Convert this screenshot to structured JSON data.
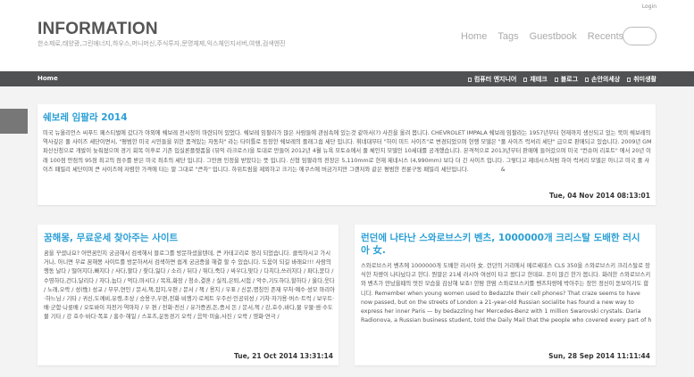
{
  "header": {
    "login": "Login",
    "site_title": "INFORMATION",
    "tagline": "한소제로,태양광,그린에너지,하우스,머니머신,주식투자,문명체제,익스체인지서버,여행,검색엔진",
    "nav": [
      "Home",
      "Tags",
      "Guestbook",
      "Recents"
    ]
  },
  "catbar": {
    "home": "Home",
    "items": [
      "컴퓨터 엔지니어",
      "재테크",
      "블로그",
      "손안의세상",
      "취미생활"
    ]
  },
  "posts": [
    {
      "title": "쉐보레 임팔라 2014",
      "body": "미국 뉴올리언스 씨푸드 페스티벌에 갔다가 야외에 쉐보레 전시장이 마련되어 있었다. 쉐보레 임팔라가 많은 사람들에 관심속에 있는것 같아서(?) 사진을 올려 봅니다. CHEVROLET IMPALA 쉐보레 임팔라는 1957년부터 현재까지 생산되고 있는 북미 쉐보레의 역사깊은 풀 사이즈 세단이면서, \"평범한 미국 시민들을 위한 품격있는 자동차\" 라는 타이틀로 등장한 쉐보레의 플래그쉽 세단 입니다. 휘네대부터 \"하이 미드 사이즈\"로 변경되었으며 현행 모델은 \"풀 사이즈 럭셔리 세단\" 급으로 판매되고 있습니다. 2009년 GM 파산신청으로 개발이 늦춰졌으며 경기 회복 이후로 기존 입실론플랫폼을 (뷰익 라크로스)을 토대로 만들어 2012년 4월 뉴욕 모토쇼에서 풀 체인지 모델인 10세대를 공개했습니다. 본격적으로 2013년부터 판매에 들어갔으며 미국 \"컨슈머 리포트\" 에서 20년 이래 100점 만점의 95점 최고의 점수를 받은 미국 최초의 세단 입니다. 그만큼 인정을 받았다는 뜻 입니다. 신형 임팔라의 전장은 5,110mm로 현재 제네시스 (4,990mm) 보다 더 긴 사이즈 입니다. 그렇다고 제네시스처럼 하이 럭셔리 모델은 아니고 미국 풀 사이즈 패밀리 세단이며 큰 사이즈에 저렴한 가격에 타는 말 그대로 \"큰차\" 입니다. 하위트림을 제외하고 크기는 에쿠스에 버금가지만 그랜저와 같은 평범한 전륜구동 패밀리 세단입니다.",
      "extra": "&",
      "date": "Tue, 04 Nov 2014 08:13:01"
    },
    {
      "title": "꿈해몽, 무료운세 찾아주는 사이트",
      "body": "꿈을 꾸셨나요? 어떤꿈인지 궁금해서 검색해서 블로그를 방문하셨을텐데, 큰 카테고리로 정리 되었습니다. 클릭하시고 가시거나, 아니면 무료 꿈해몽 사이트를 방문하셔서 검색하면 쉽게 궁금증을 해결 할 수 있습니다. 도움이 되길 바래요!!! 사람의 행동 날다 / 떨어지다,빠지다 / 사다,팔다 / 찾다,잃다 / 소리 / 뒤다 / 뛰다,죽다 / 싸우다,맞다 / 다치다,쓰러지다 / 파다,묻다 / 수영하다,건다,달리다 / 자다,눕다 / 먹다,마시다 / 목욕,화장 / 청소,결혼 / 실직,은퇴,시험 / 악수,기도하다,할하다 / 울다,웃다 / 노래,오락 / 성(性) 성교 / 부부,연인 / 문서,책,잡지,우편 / 문서 / 책 / 용지 / 우표 / 신문,명칭인 존재 부처·예수·성모 마리아·하느님 / 기타 / 귀신,도깨비,유령,조상 / 승용구,우편,전화 비행기·로케트 우주선·인공위성 / 기차·자가용·버스·트럭 / 보우트·배·군함·나룻배 / 오토바이 자전거·역마차 / 우 편 / 전화·전신 / 유가증권,돈,증서 돈 / 문서,책 / 강,호수,바다,물 우물·샘·수도물 기타 / 강 호수·바다·폭포 / 홍수·해일 / 스포츠,운동경기 오락 / 음악·미술,사진 / 오락 / 영화·연극 /",
      "date": "Tue, 21 Oct 2014 13:31:14"
    },
    {
      "title": "런던에 나타난 스와로브스키 벤츠, 1000000개 크리스탈 도배한 러시아 女.",
      "body": "스와로브스키 벤츠에 1000000개 도배한 러시아 女. 런던의 거리에서 메르세데스 CLS 350을 스와로브스키 크리스탈로 장식한 차량이 나타났다고 한다. 뭔말은 21세 러시아 여성이 타고 왔다고 한데요. 돈이 많긴 한가 봅니다. 화려한 스와로브스키와 벤츠가 만났을때의 멋진 모습을 감상해 보죠! 한땀 한땀 스와로브스키를 벤츠차량에 박아주는 장인 정신이 돋보이기도 합니다. Remember when young women used to Bedazzle their cell phones? That craze seems to have now passed, but on the streets of London a 21-year-old Russian socialite has found a new way to express her inner Paris — by bedazzling her Mercedes-Benz with 1 million Swarovski crystals. Daria Radionova, a Russian business student, told the Daily Mail that the people who covered every part of h",
      "date": "Sun, 28 Sep 2014 11:11:44"
    }
  ]
}
